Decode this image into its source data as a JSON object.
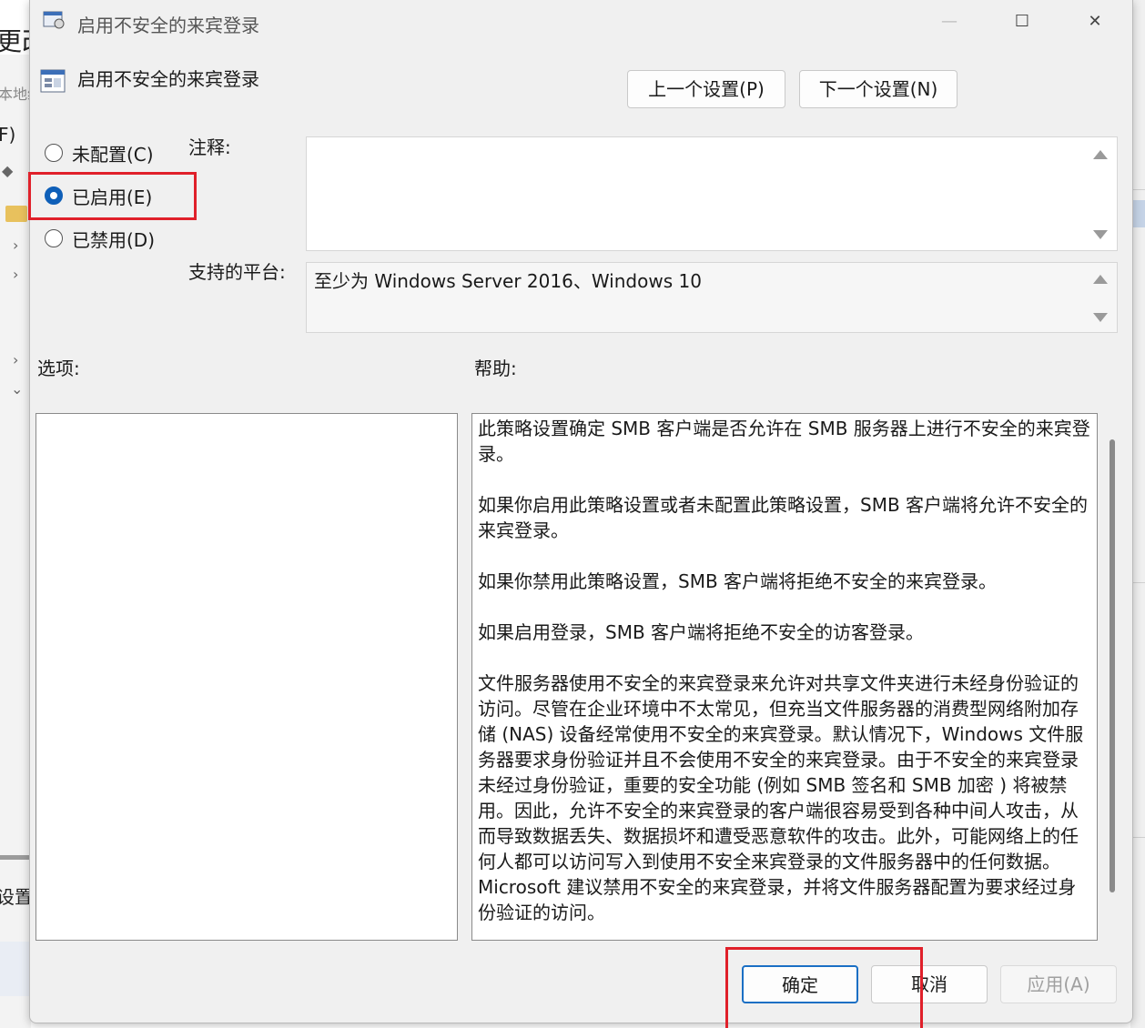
{
  "background": {
    "title_fragment": "更改",
    "sub_fragment": "本地组",
    "menu_fragment": "F)",
    "status_fragment": "设置"
  },
  "dialog": {
    "title": "启用不安全的来宾登录",
    "window_controls": {
      "minimize": "—",
      "maximize": "☐",
      "close": "✕"
    },
    "policy_name": "启用不安全的来宾登录",
    "nav": {
      "prev": "上一个设置(P)",
      "next": "下一个设置(N)"
    },
    "options": [
      {
        "label": "未配置(C)",
        "checked": false
      },
      {
        "label": "已启用(E)",
        "checked": true
      },
      {
        "label": "已禁用(D)",
        "checked": false
      }
    ],
    "comment_label": "注释:",
    "comment_value": "",
    "platform_label": "支持的平台:",
    "platform_value": "至少为 Windows Server 2016、Windows 10",
    "options_label": "选项:",
    "help_label": "帮助:",
    "help_paragraphs": [
      "此策略设置确定 SMB 客户端是否允许在 SMB 服务器上进行不安全的来宾登录。",
      "如果你启用此策略设置或者未配置此策略设置，SMB 客户端将允许不安全的来宾登录。",
      "如果你禁用此策略设置，SMB 客户端将拒绝不安全的来宾登录。",
      "如果启用登录，SMB 客户端将拒绝不安全的访客登录。",
      "文件服务器使用不安全的来宾登录来允许对共享文件夹进行未经身份验证的访问。尽管在企业环境中不太常见，但充当文件服务器的消费型网络附加存储 (NAS) 设备经常使用不安全的来宾登录。默认情况下，Windows 文件服务器要求身份验证并且不会使用不安全的来宾登录。由于不安全的来宾登录未经过身份验证，重要的安全功能 (例如 SMB 签名和 SMB 加密 ) 将被禁用。因此，允许不安全的来宾登录的客户端很容易受到各种中间人攻击，从而导致数据丢失、数据损坏和遭受恶意软件的攻击。此外，可能网络上的任何人都可以访问写入到使用不安全来宾登录的文件服务器中的任何数据。Microsoft 建议禁用不安全的来宾登录，并将文件服务器配置为要求经过身份验证的访问。"
    ],
    "buttons": {
      "ok": "确定",
      "cancel": "取消",
      "apply": "应用(A)"
    }
  },
  "colors": {
    "accent": "#0e5fb8",
    "highlight": "#e0202a"
  }
}
